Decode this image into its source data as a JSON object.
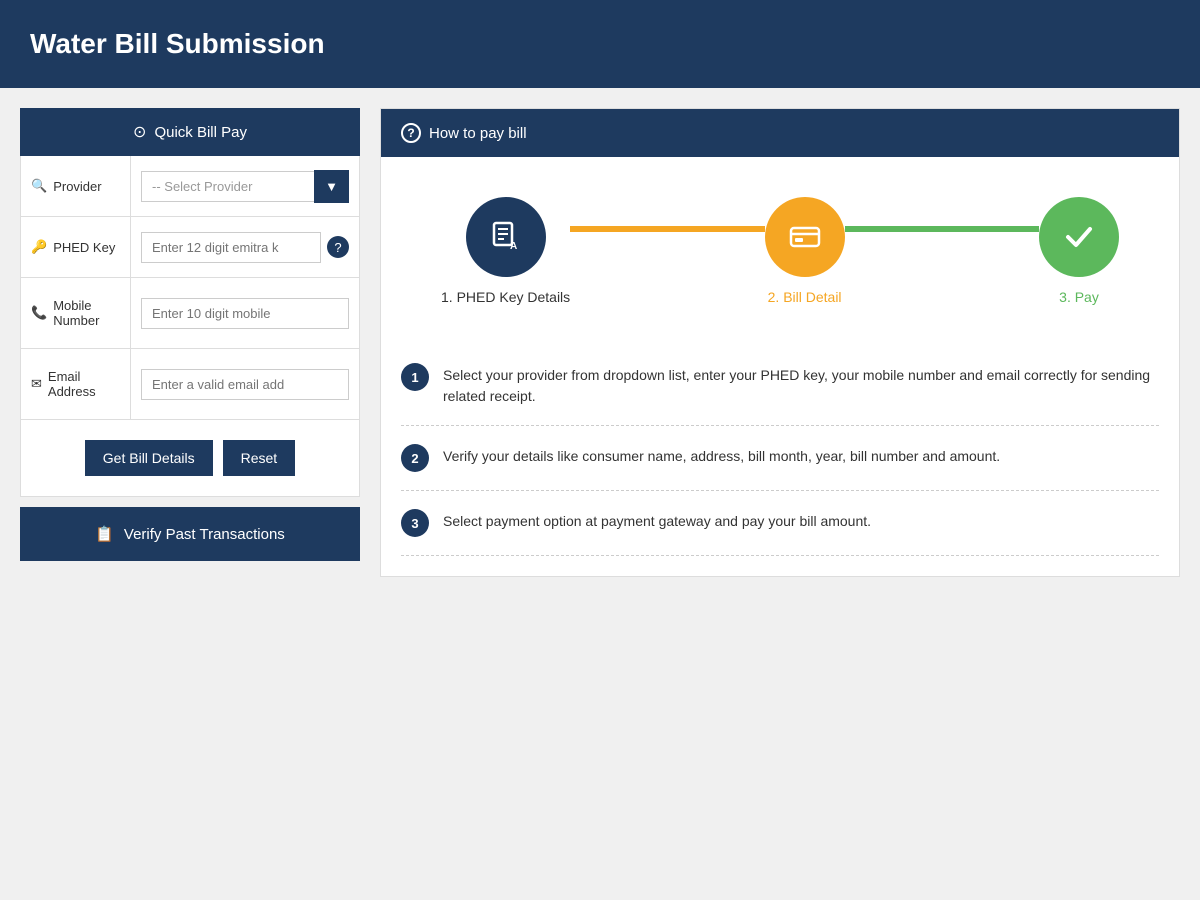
{
  "header": {
    "title": "Water Bill Submission"
  },
  "left_panel": {
    "quick_bill_title": "Quick Bill Pay",
    "quick_bill_icon": "⊙",
    "form": {
      "provider_label": "Provider",
      "provider_icon": "♀",
      "provider_placeholder": "-- Select Provider",
      "phed_label": "PHED Key",
      "phed_icon": "⊞",
      "phed_placeholder": "Enter 12 digit emitra k",
      "mobile_label": "Mobile Number",
      "mobile_icon": "✆",
      "mobile_placeholder": "Enter 10 digit mobile",
      "email_label": "Email Address",
      "email_icon": "✉",
      "email_placeholder": "Enter a valid email add"
    },
    "get_bill_btn": "Get Bill Details",
    "reset_btn": "Reset",
    "verify_btn": "Verify Past Transactions",
    "verify_icon": "✔"
  },
  "right_panel": {
    "how_to_title": "How to pay bill",
    "how_to_icon": "?",
    "steps": [
      {
        "number": "1",
        "label": "1. PHED Key Details",
        "color_class": "step-circle-1",
        "label_class": "step-label-1"
      },
      {
        "number": "2",
        "label": "2. Bill Detail",
        "color_class": "step-circle-2",
        "label_class": "step-label-2"
      },
      {
        "number": "3",
        "label": "3. Pay",
        "color_class": "step-circle-3",
        "label_class": "step-label-3"
      }
    ],
    "instructions": [
      {
        "num": "1",
        "text": "Select your provider from dropdown list, enter your PHED key, your mobile number and email correctly for sending related receipt."
      },
      {
        "num": "2",
        "text": "Verify your details like consumer name, address, bill month, year, bill number and amount."
      },
      {
        "num": "3",
        "text": "Select payment option at payment gateway and pay your bill amount."
      }
    ]
  }
}
